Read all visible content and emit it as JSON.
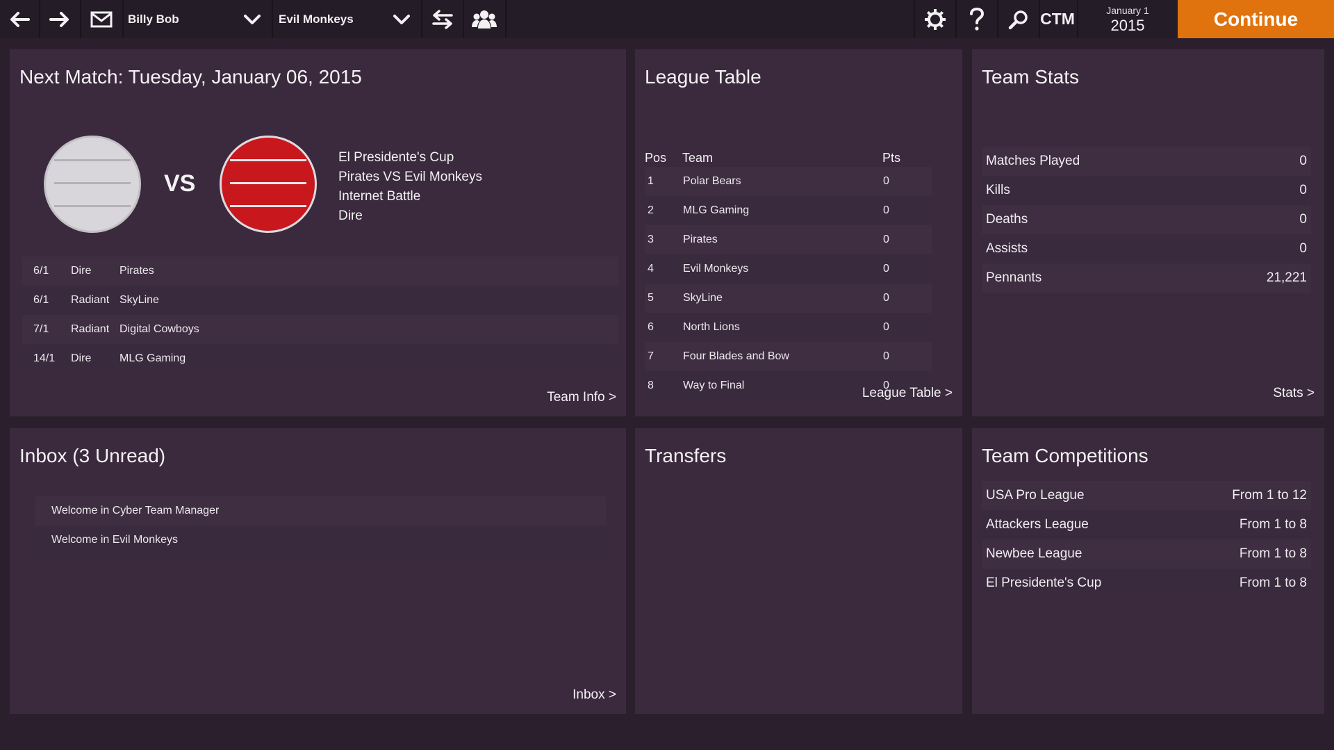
{
  "topbar": {
    "back_icon": "arrow-left-icon",
    "forward_icon": "arrow-right-icon",
    "mail_icon": "envelope-icon",
    "manager_name": "Billy Bob",
    "team_name": "Evil Monkeys",
    "ctm_label": "CTM",
    "date_day": "January 1",
    "date_year": "2015",
    "continue_label": "Continue",
    "accent_color": "#e0730d"
  },
  "next_match": {
    "title": "Next Match: Tuesday, January 06, 2015",
    "vs_label": "VS",
    "home_crest_color": "#d8d6da",
    "away_crest_color": "#c8181d",
    "info": [
      "El Presidente's Cup",
      "Pirates VS Evil Monkeys",
      "Internet Battle",
      "Dire"
    ],
    "fixtures": [
      {
        "date": "6/1",
        "side": "Dire",
        "opponent": "Pirates"
      },
      {
        "date": "6/1",
        "side": "Radiant",
        "opponent": "SkyLine"
      },
      {
        "date": "7/1",
        "side": "Radiant",
        "opponent": "Digital Cowboys"
      },
      {
        "date": "14/1",
        "side": "Dire",
        "opponent": "MLG Gaming"
      }
    ],
    "link_label": "Team Info >"
  },
  "league_table": {
    "title": "League Table",
    "headers": {
      "pos": "Pos",
      "team": "Team",
      "pts": "Pts"
    },
    "rows": [
      {
        "pos": "1",
        "team": "Polar Bears",
        "pts": "0"
      },
      {
        "pos": "2",
        "team": "MLG Gaming",
        "pts": "0"
      },
      {
        "pos": "3",
        "team": "Pirates",
        "pts": "0"
      },
      {
        "pos": "4",
        "team": "Evil Monkeys",
        "pts": "0"
      },
      {
        "pos": "5",
        "team": "SkyLine",
        "pts": "0"
      },
      {
        "pos": "6",
        "team": "North Lions",
        "pts": "0"
      },
      {
        "pos": "7",
        "team": "Four Blades and Bow",
        "pts": "0"
      },
      {
        "pos": "8",
        "team": "Way to Final",
        "pts": "0"
      }
    ],
    "link_label": "League Table >"
  },
  "team_stats": {
    "title": "Team Stats",
    "rows": [
      {
        "label": "Matches Played",
        "value": "0"
      },
      {
        "label": "Kills",
        "value": "0"
      },
      {
        "label": "Deaths",
        "value": "0"
      },
      {
        "label": "Assists",
        "value": "0"
      },
      {
        "label": "Pennants",
        "value": "21,221"
      }
    ],
    "link_label": "Stats >"
  },
  "inbox": {
    "title": "Inbox (3 Unread)",
    "messages": [
      "Welcome in Cyber Team Manager",
      "Welcome in Evil Monkeys"
    ],
    "link_label": "Inbox >"
  },
  "transfers": {
    "title": "Transfers"
  },
  "competitions": {
    "title": "Team Competitions",
    "rows": [
      {
        "name": "USA Pro League",
        "range": "From 1 to 12"
      },
      {
        "name": "Attackers League",
        "range": "From 1 to 8"
      },
      {
        "name": "Newbee League",
        "range": "From 1 to 8"
      },
      {
        "name": "El Presidente's Cup",
        "range": "From 1 to 8"
      }
    ]
  }
}
